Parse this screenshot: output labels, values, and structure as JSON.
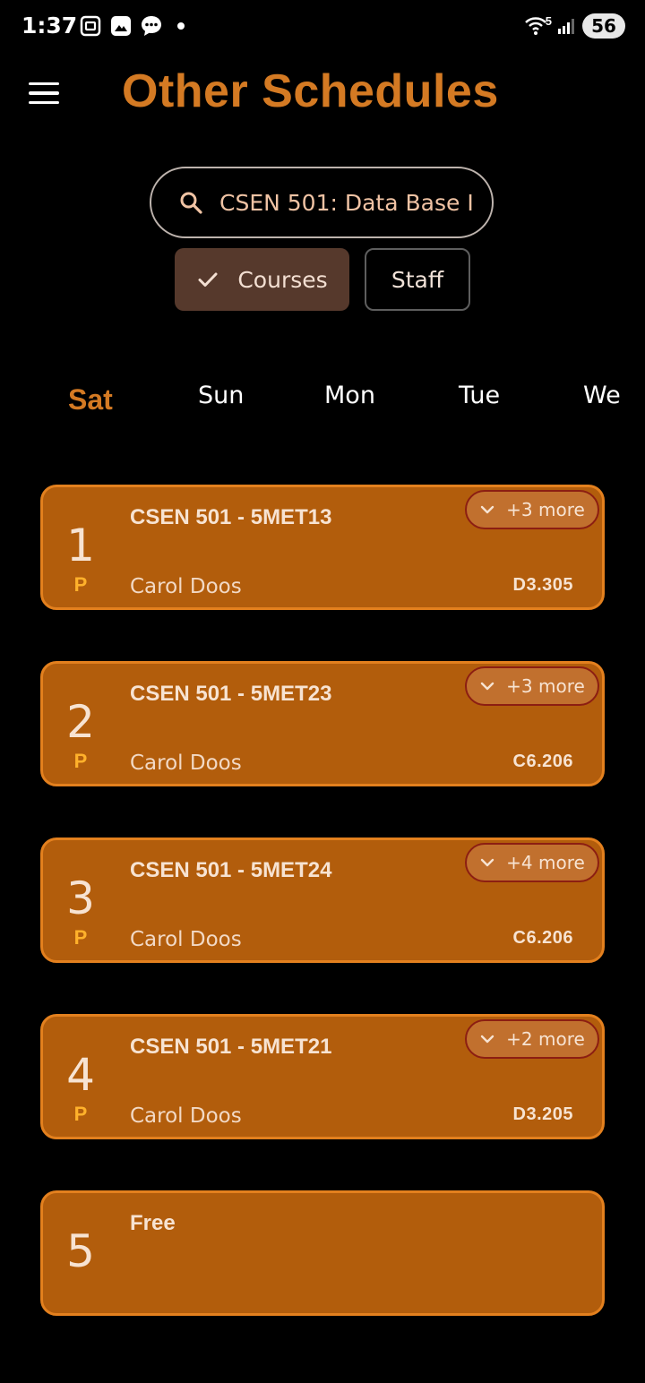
{
  "status_bar": {
    "time": "1:37",
    "battery": "56",
    "network": "5"
  },
  "header": {
    "title": "Other Schedules"
  },
  "search": {
    "value": "CSEN 501: Data Base I"
  },
  "filters": {
    "courses_label": "Courses",
    "staff_label": "Staff",
    "selected": "Courses"
  },
  "days": [
    "Sat",
    "Sun",
    "Mon",
    "Tue",
    "We"
  ],
  "selected_day": "Sat",
  "slots": [
    {
      "number": "1",
      "type": "P",
      "title": "CSEN 501 - 5MET13",
      "staff": "Carol Doos",
      "room": "D3.305",
      "more": "+3 more"
    },
    {
      "number": "2",
      "type": "P",
      "title": "CSEN 501 - 5MET23",
      "staff": "Carol Doos",
      "room": "C6.206",
      "more": "+3 more"
    },
    {
      "number": "3",
      "type": "P",
      "title": "CSEN 501 - 5MET24",
      "staff": "Carol Doos",
      "room": "C6.206",
      "more": "+4 more"
    },
    {
      "number": "4",
      "type": "P",
      "title": "CSEN 501 - 5MET21",
      "staff": "Carol Doos",
      "room": "D3.205",
      "more": "+2 more"
    },
    {
      "number": "5",
      "title": "Free"
    }
  ],
  "colors": {
    "accent": "#d47a23",
    "card_bg": "#b25d0c",
    "card_border": "#e3801e",
    "type_label": "#ffb12b"
  }
}
